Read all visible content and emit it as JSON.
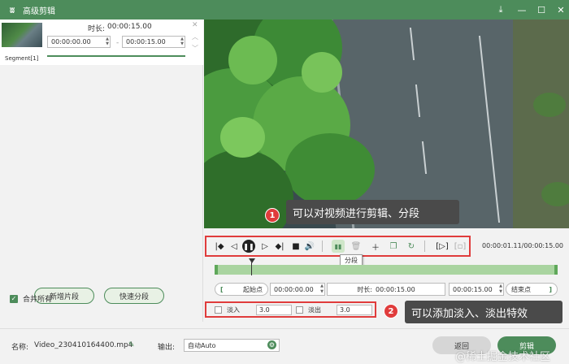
{
  "window": {
    "title": "高级剪辑",
    "logo_icon": "app-logo-icon",
    "controls": [
      "download-icon",
      "minimize-icon",
      "maximize-icon",
      "close-icon"
    ]
  },
  "segment": {
    "label": "Segment[1]",
    "duration_label": "时长:",
    "duration_value": "00:00:15.00",
    "start_time": "00:00:00.00",
    "end_time": "00:00:15.00",
    "separator": "-"
  },
  "left_buttons": {
    "new_segment": "新增片段",
    "quick_split": "快速分段"
  },
  "merge_all": {
    "label": "合并所有",
    "checked": true
  },
  "callouts": {
    "one": {
      "num": "1",
      "text": "可以对视频进行剪辑、分段"
    },
    "two": {
      "num": "2",
      "text": "可以添加淡入、淡出特效"
    }
  },
  "player": {
    "timecode": "00:00:01.11/00:00:15.00",
    "tooltip": "分段",
    "playhead_position": 0.1
  },
  "trim": {
    "start_label": "起始点",
    "start_value": "00:00:00.00",
    "duration_label": "时长:",
    "duration_value": "00:00:15.00",
    "end_value": "00:00:15.00",
    "end_label": "结束点",
    "bracket_left": "[",
    "bracket_right": "]"
  },
  "fade": {
    "in_label": "淡入",
    "in_value": "3.0",
    "out_label": "淡出",
    "out_value": "3.0"
  },
  "bottom": {
    "name_label": "名称:",
    "file_name": "Video_230410164400.mp4",
    "output_label": "输出:",
    "output_value": "自动Auto",
    "back_button": "返回",
    "cut_button": "剪辑",
    "watermark": "@稀土掘金技术社区"
  },
  "colors": {
    "brand_green": "#4d8c5b",
    "highlight_red": "#e03c3c",
    "timeline_green": "#a9d4a0"
  }
}
